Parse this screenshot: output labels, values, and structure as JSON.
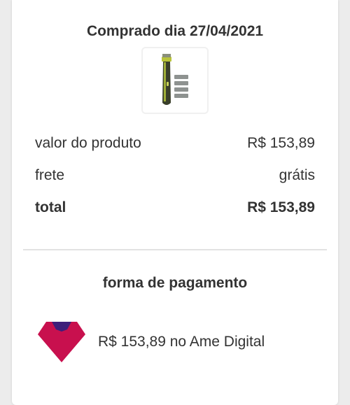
{
  "purchase": {
    "date_label": "Comprado dia 27/04/2021"
  },
  "product": {
    "image_icon": "beard-trimmer-product-image"
  },
  "summary": {
    "rows": [
      {
        "label": "valor do produto",
        "value": "R$ 153,89"
      },
      {
        "label": "frete",
        "value": "grátis"
      },
      {
        "label": "total",
        "value": "R$ 153,89"
      }
    ]
  },
  "payment": {
    "title": "forma de pagamento",
    "method_text": "R$ 153,89 no Ame Digital",
    "logo_icon": "ame-digital-logo",
    "colors": {
      "logo_primary": "#c8104e",
      "logo_accent": "#3d1e7a"
    }
  }
}
